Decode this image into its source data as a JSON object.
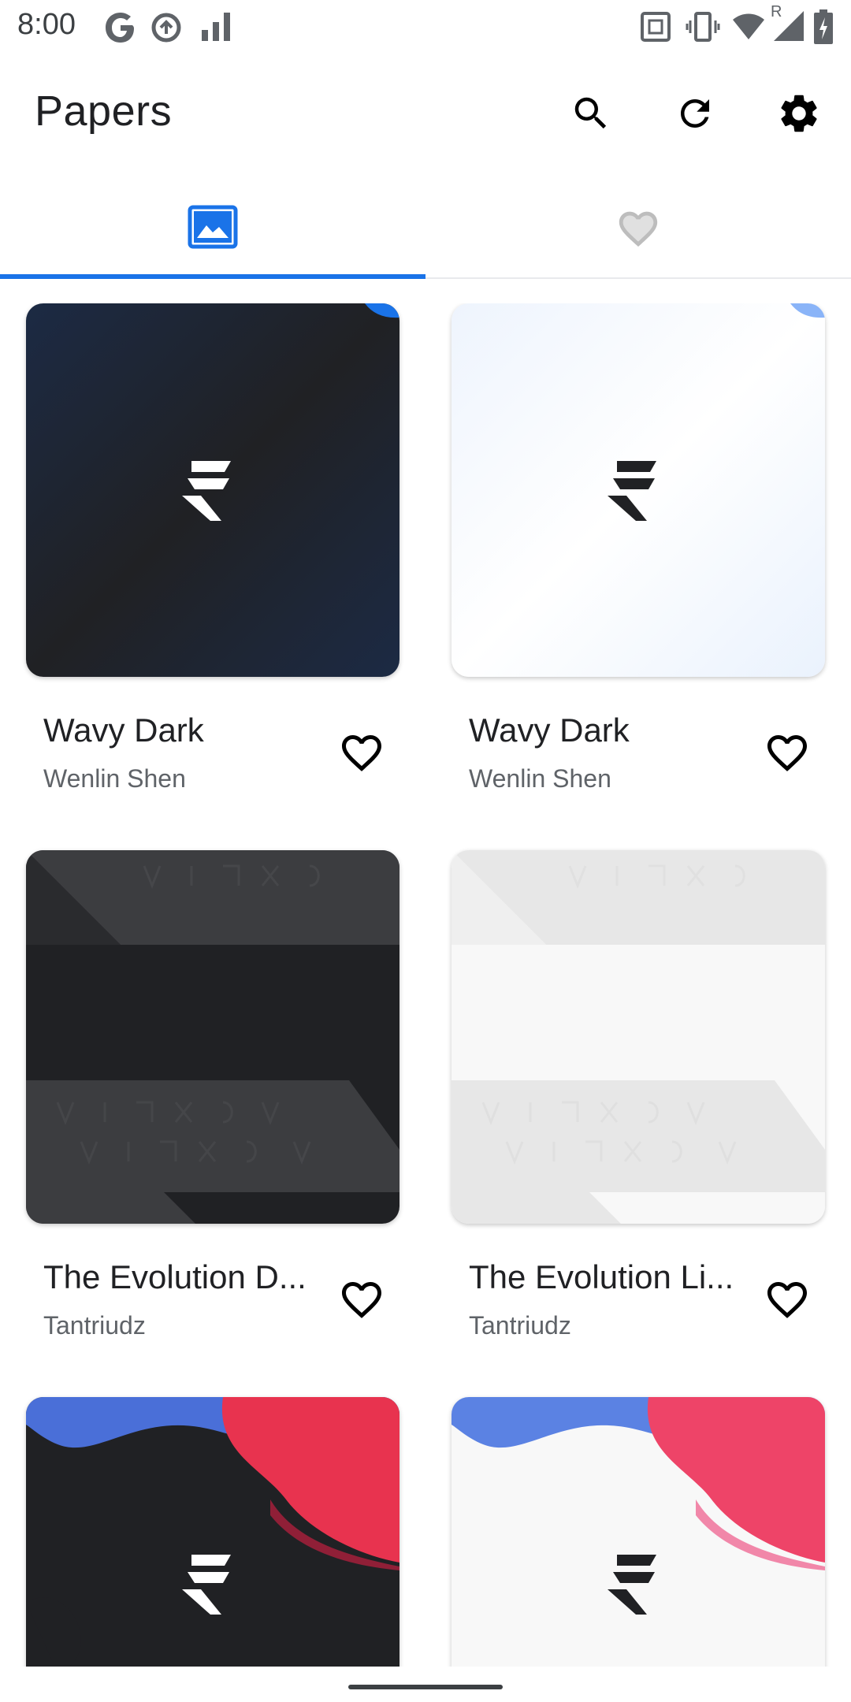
{
  "status_bar": {
    "time": "8:00",
    "left_icons": [
      "google-icon",
      "data-saver-icon",
      "signal-icon"
    ],
    "right_icons": [
      "nfc-icon",
      "vibrate-icon",
      "wifi-icon",
      "roaming-signal-icon",
      "battery-icon"
    ],
    "roaming_label": "R"
  },
  "app_bar": {
    "title": "Papers",
    "actions": [
      "search-icon",
      "refresh-icon",
      "settings-icon"
    ]
  },
  "tabs": [
    {
      "icon": "wallpaper-icon",
      "selected": true
    },
    {
      "icon": "heart-icon",
      "selected": false
    }
  ],
  "colors": {
    "accent": "#1a73e8",
    "tab_inactive": "#9aa0a6"
  },
  "wallpapers": [
    {
      "title": "Wavy Dark",
      "author": "Wenlin Shen",
      "thumb": "wavy-dark"
    },
    {
      "title": "Wavy Dark",
      "author": "Wenlin Shen",
      "thumb": "wavy-light"
    },
    {
      "title": "The Evolution D...",
      "author": "Tantriudz",
      "thumb": "evolution-dark"
    },
    {
      "title": "The Evolution Li...",
      "author": "Tantriudz",
      "thumb": "evolution-light"
    },
    {
      "title": "",
      "author": "",
      "thumb": "blobs-dark"
    },
    {
      "title": "",
      "author": "",
      "thumb": "blobs-light"
    }
  ]
}
